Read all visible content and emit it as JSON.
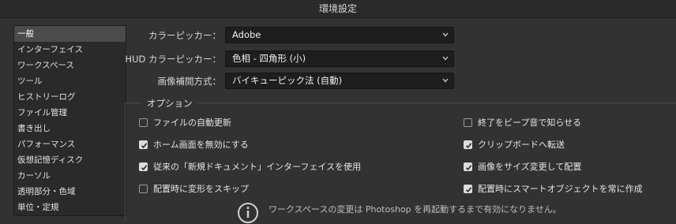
{
  "window": {
    "title": "環境設定"
  },
  "sidebar": {
    "items": [
      {
        "label": "一般",
        "selected": true
      },
      {
        "label": "インターフェイス"
      },
      {
        "label": "ワークスペース"
      },
      {
        "label": "ツール"
      },
      {
        "label": "ヒストリーログ"
      },
      {
        "label": "ファイル管理"
      },
      {
        "label": "書き出し"
      },
      {
        "label": "パフォーマンス"
      },
      {
        "label": "仮想記憶ディスク"
      },
      {
        "label": "カーソル"
      },
      {
        "label": "透明部分・色域"
      },
      {
        "label": "単位・定規"
      }
    ]
  },
  "general": {
    "color_picker": {
      "label": "カラーピッカー：",
      "value": "Adobe"
    },
    "hud_color_picker": {
      "label": "HUD カラーピッカー：",
      "value": "色相 - 四角形 (小)"
    },
    "interpolation": {
      "label": "画像補間方式：",
      "value": "バイキューピック法 (自動)"
    }
  },
  "options": {
    "legend": "オプション",
    "left": [
      {
        "label": "ファイルの自動更新",
        "checked": false
      },
      {
        "label": "ホーム画面を無効にする",
        "checked": true
      },
      {
        "label": "従来の「新規ドキュメント」インターフェイスを使用",
        "checked": true
      },
      {
        "label": "配置時に変形をスキップ",
        "checked": false
      }
    ],
    "right": [
      {
        "label": "終了をビープ音で知らせる",
        "checked": false
      },
      {
        "label": "クリップボードへ転送",
        "checked": true
      },
      {
        "label": "画像をサイズ変更して配置",
        "checked": true
      },
      {
        "label": "配置時にスマートオブジェクトを常に作成",
        "checked": true
      }
    ]
  },
  "notice": {
    "text": "ワークスペースの変更は Photoshop を再起動するまで有効になりません。",
    "icon": "info-icon"
  }
}
